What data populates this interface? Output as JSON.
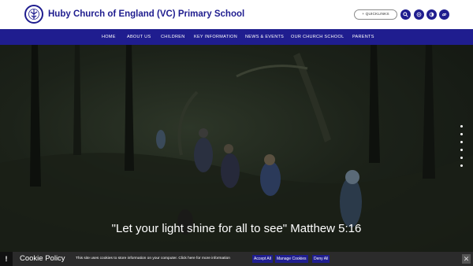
{
  "header": {
    "school_name": "Huby Church of England (VC) Primary School",
    "quicklinks_label": "+ QUICKLINKS",
    "icons": [
      "search-icon",
      "translate-icon",
      "accessibility-icon",
      "link-icon"
    ]
  },
  "nav": {
    "items": [
      {
        "label": "HOME"
      },
      {
        "label": "ABOUT US"
      },
      {
        "label": "CHILDREN"
      },
      {
        "label": "KEY INFORMATION"
      },
      {
        "label": "NEWS & EVENTS"
      },
      {
        "label": "OUR CHURCH SCHOOL"
      },
      {
        "label": "PARENTS"
      }
    ]
  },
  "hero": {
    "quote": "\"Let your light shine for all to see\" Matthew 5:16",
    "slide_count": 6
  },
  "cookie": {
    "title": "Cookie Policy",
    "text": "This site uses cookies to store information on your computer. Click here for more information",
    "accept_label": "Accept All",
    "manage_label": "Manage Cookies",
    "deny_label": "Deny All",
    "close_label": "✕",
    "alert_label": "!"
  },
  "colors": {
    "brand": "#1f1d8f",
    "cookie_bar": "#2b2b2b"
  }
}
